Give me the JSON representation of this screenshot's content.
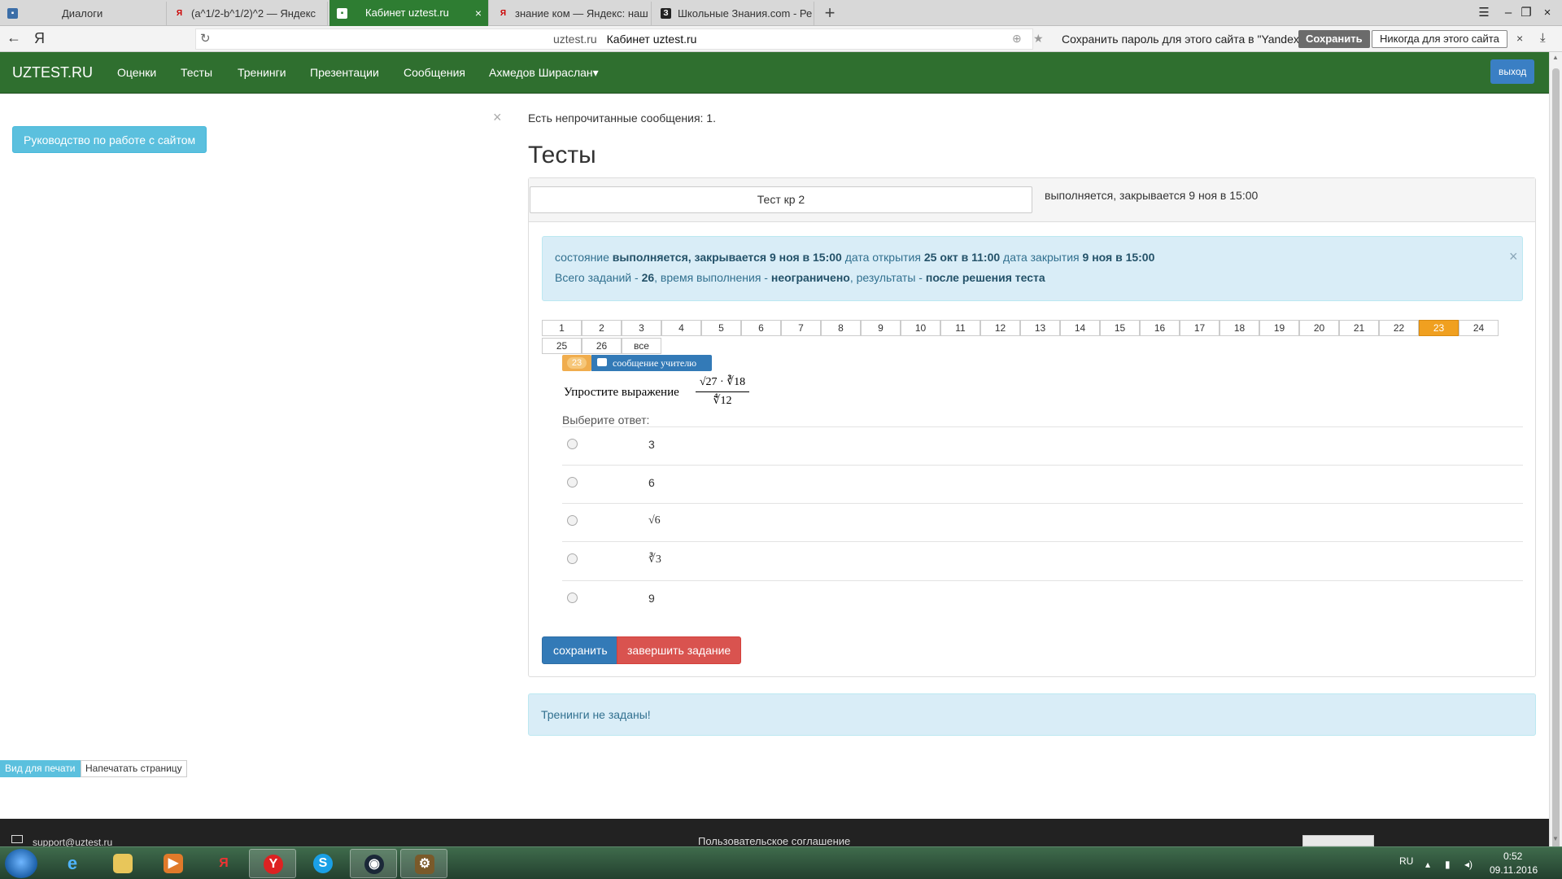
{
  "browser": {
    "tabs": [
      {
        "label": "Диалоги",
        "icon": "dialogs-icon",
        "glyph": "▪"
      },
      {
        "label": "(a^1/2-b^1/2)^2 — Яндекс",
        "icon": "yandex-icon",
        "glyph": "Я"
      },
      {
        "label": "Кабинет uztest.ru",
        "icon": "uztest-icon",
        "glyph": "▪"
      },
      {
        "label": "знание ком — Яндекс: наш",
        "icon": "yandex-icon",
        "glyph": "Я"
      },
      {
        "label": "Школьные Знания.com - Ре",
        "icon": "znanija-icon",
        "glyph": "З"
      }
    ],
    "active_tab_close": "×",
    "new_tab": "+",
    "window_controls": [
      "☰",
      "–",
      "❐",
      "×"
    ],
    "address": {
      "back": "←",
      "yandex_logo": "Я",
      "reload": "↻",
      "domain": "uztest.ru",
      "page_title": "Кабинет uztest.ru",
      "protect": "⊕",
      "star": "★"
    },
    "password_prompt": {
      "text": "Сохранить пароль для этого сайта в \"Yandex\"?",
      "save": "Сохранить",
      "never": "Никогда для этого сайта",
      "close": "×"
    },
    "download": "⤓"
  },
  "navbar": {
    "brand": "UZTEST.RU",
    "links": [
      "Оценки",
      "Тесты",
      "Тренинги",
      "Презентации",
      "Сообщения"
    ],
    "user": "Ахмедов Шираслан",
    "caret": "▾",
    "exit": "выход"
  },
  "sidebar": {
    "guide_button": "Руководство по работе с сайтом",
    "print_view": "Вид для печати",
    "print_page": "Напечатать страницу"
  },
  "notice": {
    "text": "Есть непрочитанные сообщения: 1.",
    "close": "×"
  },
  "page": {
    "title": "Тесты",
    "test_name": "Тест кр 2",
    "test_status": "выполняется, закрывается 9 ноя в 15:00"
  },
  "info": {
    "state_label": "состояние",
    "state_value": "выполняется, закрывается 9 ноя в 15:00",
    "open_label": "дата открытия",
    "open_value": "25 окт в 11:00",
    "close_label": "дата закрытия",
    "close_value": "9 ноя в 15:00",
    "tasks_label": "Всего заданий -",
    "tasks_value": "26",
    "time_label": ", время выполнения -",
    "time_value": "неограничено",
    "results_label": ", результаты -",
    "results_value": "после решения теста",
    "close": "×"
  },
  "questions": {
    "items": [
      "1",
      "2",
      "3",
      "4",
      "5",
      "6",
      "7",
      "8",
      "9",
      "10",
      "11",
      "12",
      "13",
      "14",
      "15",
      "16",
      "17",
      "18",
      "19",
      "20",
      "21",
      "22",
      "23",
      "24",
      "25",
      "26",
      "все"
    ],
    "active": "23",
    "highlight_color": "#f0a020"
  },
  "question": {
    "number_badge": "23",
    "message_label": "сообщение учителю",
    "text": "Упростите выражение",
    "numerator_a": "√27",
    "dot": "·",
    "numerator_b": "∛18",
    "denominator": "∜12",
    "choose_label": "Выберите ответ:",
    "answers": [
      "3",
      "6",
      "√6",
      "∛3",
      "9"
    ]
  },
  "actions": {
    "save": "сохранить",
    "finish": "завершить задание"
  },
  "trainings": {
    "text": "Тренинги не заданы!"
  },
  "footer": {
    "email": "support@uztest.ru",
    "terms": "Пользовательское соглашение"
  },
  "taskbar": {
    "lang": "RU",
    "time": "0:52",
    "date": "09.11.2016",
    "tray_arrow": "▴",
    "signal": "▮",
    "volume": "◂)"
  },
  "colors": {
    "navbar": "#2f6f2f",
    "active_tab": "#2e7d32",
    "primary": "#337ab7",
    "danger": "#d9534f",
    "info": "#5bc0de"
  }
}
